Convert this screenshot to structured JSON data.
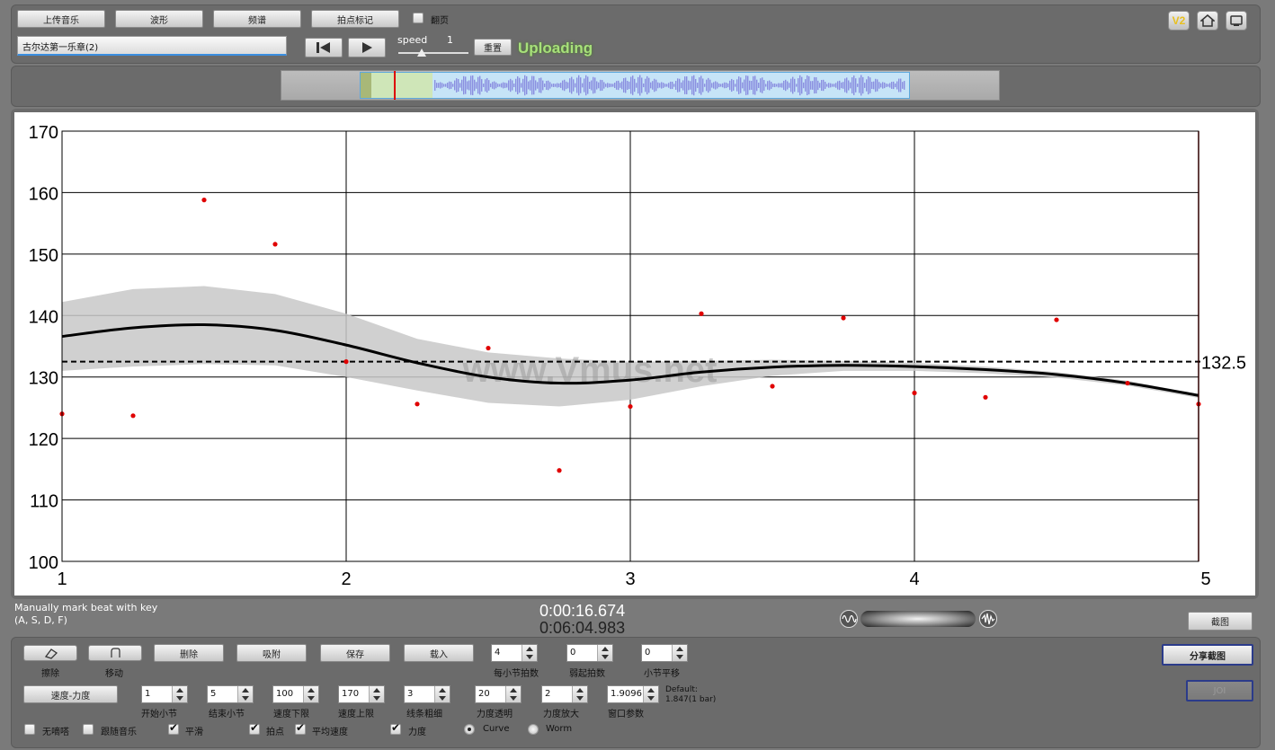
{
  "toolbar": {
    "upload_music": "上传音乐",
    "waveform": "波形",
    "spectrum": "频谱",
    "beat_marking": "拍点标记",
    "page_turn": "翻页",
    "track_name": "古尔达第一乐章(2)",
    "speed_label": "speed",
    "speed_value": "1",
    "reset": "重置",
    "status": "Uploading"
  },
  "top_icons": {
    "version": "V2"
  },
  "chart_data": {
    "type": "scatter",
    "x_range": [
      1,
      5
    ],
    "y_range": [
      100,
      170
    ],
    "x_ticks": [
      "1",
      "2",
      "3",
      "4",
      "5"
    ],
    "y_ticks": [
      "100",
      "110",
      "120",
      "130",
      "140",
      "150",
      "160",
      "170"
    ],
    "grid": true,
    "points": [
      {
        "x": 1.0,
        "y": 124.0
      },
      {
        "x": 1.25,
        "y": 123.7
      },
      {
        "x": 1.5,
        "y": 158.8
      },
      {
        "x": 1.75,
        "y": 151.6
      },
      {
        "x": 2.0,
        "y": 132.5
      },
      {
        "x": 2.25,
        "y": 125.6
      },
      {
        "x": 2.5,
        "y": 134.7
      },
      {
        "x": 2.75,
        "y": 114.8
      },
      {
        "x": 3.0,
        "y": 125.2
      },
      {
        "x": 3.25,
        "y": 140.3
      },
      {
        "x": 3.5,
        "y": 128.5
      },
      {
        "x": 3.75,
        "y": 139.6
      },
      {
        "x": 4.0,
        "y": 127.4
      },
      {
        "x": 4.25,
        "y": 126.7
      },
      {
        "x": 4.5,
        "y": 139.3
      },
      {
        "x": 4.75,
        "y": 129.0
      },
      {
        "x": 5.0,
        "y": 125.6
      }
    ],
    "smooth_curve": [
      {
        "x": 1.0,
        "y": 136.6
      },
      {
        "x": 1.25,
        "y": 138.0
      },
      {
        "x": 1.5,
        "y": 138.5
      },
      {
        "x": 1.75,
        "y": 137.6
      },
      {
        "x": 2.0,
        "y": 135.2
      },
      {
        "x": 2.25,
        "y": 132.3
      },
      {
        "x": 2.5,
        "y": 130.0
      },
      {
        "x": 2.75,
        "y": 129.0
      },
      {
        "x": 3.0,
        "y": 129.5
      },
      {
        "x": 3.25,
        "y": 130.8
      },
      {
        "x": 3.5,
        "y": 131.6
      },
      {
        "x": 3.75,
        "y": 131.9
      },
      {
        "x": 4.0,
        "y": 131.7
      },
      {
        "x": 4.25,
        "y": 131.2
      },
      {
        "x": 4.5,
        "y": 130.4
      },
      {
        "x": 4.75,
        "y": 129.0
      },
      {
        "x": 5.0,
        "y": 127.0
      }
    ],
    "band_upper": [
      {
        "x": 1.0,
        "y": 142.2
      },
      {
        "x": 1.25,
        "y": 144.3
      },
      {
        "x": 1.5,
        "y": 144.8
      },
      {
        "x": 1.75,
        "y": 143.5
      },
      {
        "x": 2.0,
        "y": 140.3
      },
      {
        "x": 2.25,
        "y": 136.2
      },
      {
        "x": 2.5,
        "y": 134.0
      },
      {
        "x": 2.75,
        "y": 133.0
      },
      {
        "x": 3.0,
        "y": 132.5
      },
      {
        "x": 3.25,
        "y": 132.6
      },
      {
        "x": 3.5,
        "y": 132.8
      },
      {
        "x": 3.75,
        "y": 132.6
      },
      {
        "x": 4.0,
        "y": 132.3
      },
      {
        "x": 4.25,
        "y": 131.7
      },
      {
        "x": 4.5,
        "y": 130.8
      },
      {
        "x": 4.75,
        "y": 129.4
      },
      {
        "x": 5.0,
        "y": 127.2
      }
    ],
    "band_lower": [
      {
        "x": 1.0,
        "y": 131.0
      },
      {
        "x": 1.25,
        "y": 131.7
      },
      {
        "x": 1.5,
        "y": 132.1
      },
      {
        "x": 1.75,
        "y": 131.9
      },
      {
        "x": 2.0,
        "y": 130.0
      },
      {
        "x": 2.25,
        "y": 127.8
      },
      {
        "x": 2.5,
        "y": 125.8
      },
      {
        "x": 2.75,
        "y": 125.2
      },
      {
        "x": 3.0,
        "y": 126.3
      },
      {
        "x": 3.25,
        "y": 128.5
      },
      {
        "x": 3.5,
        "y": 130.2
      },
      {
        "x": 3.75,
        "y": 131.0
      },
      {
        "x": 4.0,
        "y": 131.0
      },
      {
        "x": 4.25,
        "y": 130.6
      },
      {
        "x": 4.5,
        "y": 129.9
      },
      {
        "x": 4.75,
        "y": 128.6
      },
      {
        "x": 5.0,
        "y": 126.6
      }
    ],
    "average_line": 132.5,
    "average_label": "132.5",
    "watermark": "www.Vmus.net",
    "colors": {
      "points": "#e00000",
      "curve": "#000000",
      "band": "#c8c8c8",
      "cursor": "#8b0000"
    }
  },
  "status": {
    "hint_line1": "Manually mark beat with key",
    "hint_line2": "(A, S, D, F)",
    "time_current": "0:00:16.674",
    "time_total": "0:06:04.983",
    "screenshot": "截图"
  },
  "controls": {
    "erase": "擦除",
    "move": "移动",
    "delete": "删除",
    "snap": "吸附",
    "save": "保存",
    "load": "载入",
    "beats_per_bar": {
      "label": "每小节拍数",
      "value": "4"
    },
    "pickup_beats": {
      "label": "弱起拍数",
      "value": "0"
    },
    "bar_shift": {
      "label": "小节平移",
      "value": "0"
    },
    "share_screenshot": "分享截图",
    "mode": "速度-力度",
    "start_bar": {
      "label": "开始小节",
      "value": "1"
    },
    "end_bar": {
      "label": "结束小节",
      "value": "5"
    },
    "tempo_min": {
      "label": "速度下限",
      "value": "100"
    },
    "tempo_max": {
      "label": "速度上限",
      "value": "170"
    },
    "line_width": {
      "label": "线条粗细",
      "value": "3"
    },
    "dyn_opacity": {
      "label": "力度透明",
      "value": "20"
    },
    "dyn_scale": {
      "label": "力度放大",
      "value": "2"
    },
    "window_param": {
      "label": "窗口参数",
      "value": "1.9096"
    },
    "default_line1": "Default:",
    "default_line2": "1.847(1 bar)",
    "disabled_btn": "JOI",
    "opt_no_metronome": "无嘀嗒",
    "opt_follow_music": "跟随音乐",
    "opt_smooth": "平滑",
    "opt_beats": "拍点",
    "opt_avg_tempo": "平均速度",
    "opt_dynamics": "力度",
    "opt_curve": "Curve",
    "opt_worm": "Worm"
  }
}
